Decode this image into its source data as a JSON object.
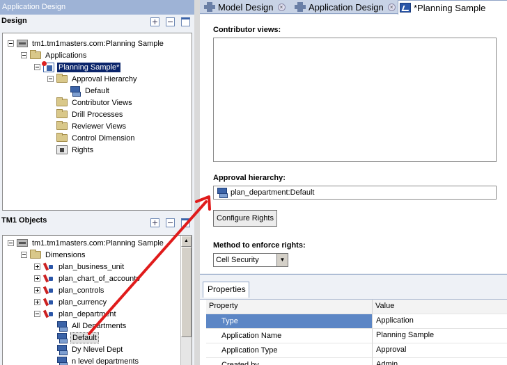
{
  "window": {
    "title": "Application Design"
  },
  "design_panel": {
    "title": "Design",
    "tree": [
      {
        "label": "tm1.tm1masters.com:Planning Sample",
        "level": 0,
        "toggle": "minus",
        "icon": "server-icon"
      },
      {
        "label": "Applications",
        "level": 1,
        "toggle": "minus",
        "icon": "folder-icon"
      },
      {
        "label": "Planning Sample*",
        "level": 2,
        "toggle": "minus",
        "icon": "application-icon",
        "selected": true
      },
      {
        "label": "Approval Hierarchy",
        "level": 3,
        "toggle": "minus",
        "icon": "folder-icon"
      },
      {
        "label": "Default",
        "level": 4,
        "toggle": "none",
        "icon": "hierarchy-icon"
      },
      {
        "label": "Contributor Views",
        "level": 3,
        "toggle": "none",
        "icon": "folder-icon"
      },
      {
        "label": "Drill Processes",
        "level": 3,
        "toggle": "none",
        "icon": "folder-icon"
      },
      {
        "label": "Reviewer Views",
        "level": 3,
        "toggle": "none",
        "icon": "folder-icon"
      },
      {
        "label": "Control Dimension",
        "level": 3,
        "toggle": "none",
        "icon": "folder-icon"
      },
      {
        "label": "Rights",
        "level": 3,
        "toggle": "none",
        "icon": "rights-icon"
      }
    ]
  },
  "objects_panel": {
    "title": "TM1 Objects",
    "tree": [
      {
        "label": "tm1.tm1masters.com:Planning Sample",
        "level": 0,
        "toggle": "minus",
        "icon": "server-icon"
      },
      {
        "label": "Dimensions",
        "level": 1,
        "toggle": "minus",
        "icon": "folder-icon"
      },
      {
        "label": "plan_business_unit",
        "level": 2,
        "toggle": "plus",
        "icon": "dimension-icon"
      },
      {
        "label": "plan_chart_of_accounts",
        "level": 2,
        "toggle": "plus",
        "icon": "dimension-icon"
      },
      {
        "label": "plan_controls",
        "level": 2,
        "toggle": "plus",
        "icon": "dimension-icon"
      },
      {
        "label": "plan_currency",
        "level": 2,
        "toggle": "plus",
        "icon": "dimension-icon"
      },
      {
        "label": "plan_department",
        "level": 2,
        "toggle": "minus",
        "icon": "dimension-icon"
      },
      {
        "label": "All Departments",
        "level": 3,
        "toggle": "none",
        "icon": "hierarchy-icon"
      },
      {
        "label": "Default",
        "level": 3,
        "toggle": "none",
        "icon": "hierarchy-icon",
        "highlighted": true
      },
      {
        "label": "Dy Nlevel Dept",
        "level": 3,
        "toggle": "none",
        "icon": "hierarchy-icon"
      },
      {
        "label": "n level departments",
        "level": 3,
        "toggle": "none",
        "icon": "hierarchy-icon"
      }
    ]
  },
  "tabs": [
    {
      "label": "Model Design",
      "icon": "model-design-icon",
      "closable": true,
      "active": false
    },
    {
      "label": "Application Design",
      "icon": "model-design-icon",
      "closable": true,
      "active": false
    },
    {
      "label": "*Planning Sample",
      "icon": "planning-app-icon",
      "closable": false,
      "active": true
    }
  ],
  "editor": {
    "contributor_views_label": "Contributor views:",
    "approval_hierarchy_label": "Approval hierarchy:",
    "approval_hierarchy_value": "plan_department:Default",
    "configure_rights_button": "Configure Rights",
    "enforce_rights_label": "Method to enforce rights:",
    "enforce_rights_value": "Cell Security"
  },
  "properties": {
    "tab_label": "Properties",
    "columns": [
      "Property",
      "Value"
    ],
    "rows": [
      {
        "property": "Type",
        "value": "Application",
        "selected": true
      },
      {
        "property": "Application Name",
        "value": "Planning Sample"
      },
      {
        "property": "Application Type",
        "value": "Approval"
      },
      {
        "property": "Created by",
        "value": "Admin"
      }
    ]
  },
  "colors": {
    "selection": "#0a246a",
    "property_selected": "#5c86c5",
    "annotation_arrow": "#e01b1b",
    "title_bar": "#9eb3d6"
  }
}
